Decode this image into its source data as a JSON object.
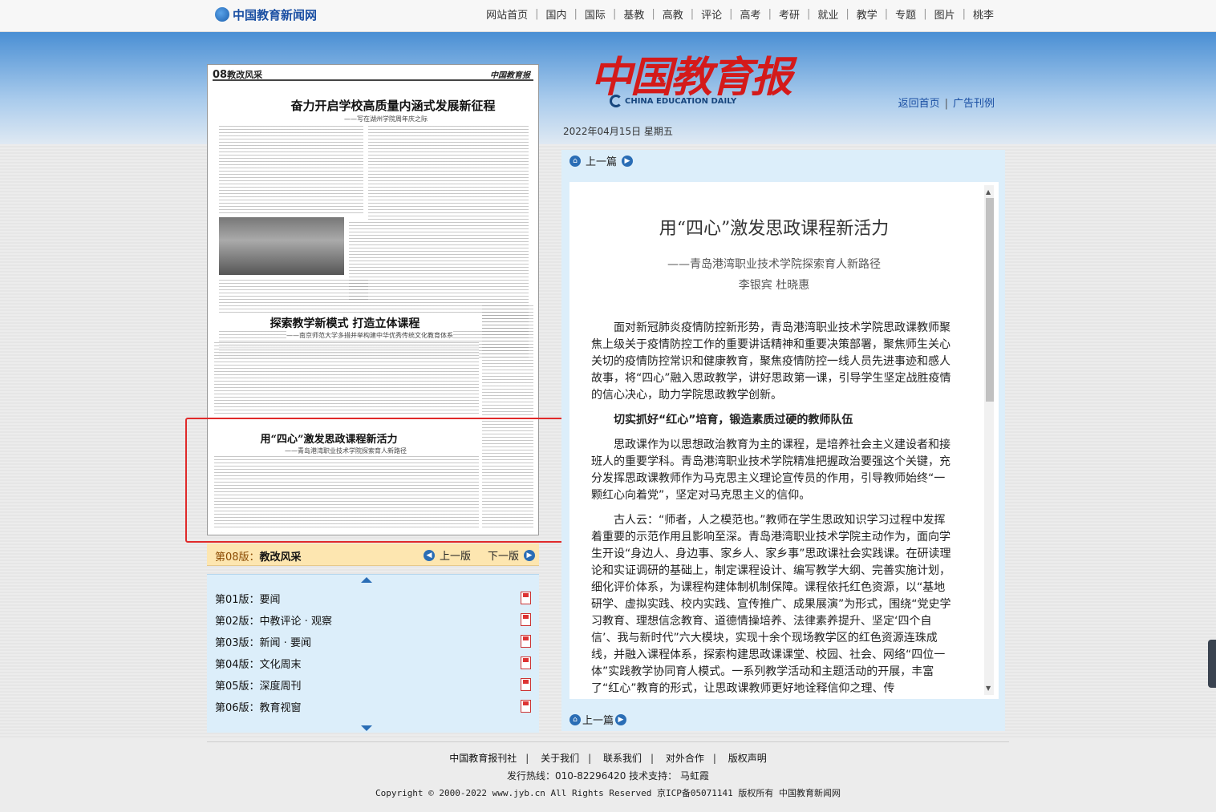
{
  "site": {
    "logo_text": "中国教育新闻网",
    "nav": [
      "网站首页",
      "国内",
      "国际",
      "基教",
      "高教",
      "评论",
      "高考",
      "考研",
      "就业",
      "教学",
      "专题",
      "图片",
      "桃李"
    ]
  },
  "masthead": {
    "paper_title": "中国教育报",
    "paper_en": "CHINA EDUCATION DAILY",
    "links": [
      "返回首页",
      "广告刊例"
    ],
    "date": "2022年04月15日 星期五"
  },
  "page_image": {
    "page_number": "08",
    "page_name": "教改风采",
    "paper_name_right": "中国教育报",
    "headline1": "奋力开启学校高质量内涵式发展新征程",
    "sub1": "——写在湖州学院周年庆之际",
    "headline2": "探索教学新模式 打造立体课程",
    "sub2": "——南京师范大学多措并举构建中华优秀传统文化教育体系",
    "headline3": "用“四心”激发思政课程新活力",
    "sub3": "——青岛港湾职业技术学院探索育人新路径"
  },
  "page_bar": {
    "current_prefix": "第08版：",
    "current_name": "教改风采",
    "prev": "上一版",
    "next": "下一版"
  },
  "page_list": [
    {
      "prefix": "第01版：",
      "name": "要闻"
    },
    {
      "prefix": "第02版：",
      "name": "中教评论 · 观察"
    },
    {
      "prefix": "第03版：",
      "name": "新闻 · 要闻"
    },
    {
      "prefix": "第04版：",
      "name": "文化周末"
    },
    {
      "prefix": "第05版：",
      "name": "深度周刊"
    },
    {
      "prefix": "第06版：",
      "name": "教育视窗"
    }
  ],
  "article": {
    "prev_top": "上一篇",
    "prev_bottom": "上一篇",
    "title": "用“四心”激发思政课程新活力",
    "subtitle": "——青岛港湾职业技术学院探索育人新路径",
    "authors": "李银宾  杜晓惠",
    "p1": "面对新冠肺炎疫情防控新形势，青岛港湾职业技术学院思政课教师聚焦上级关于疫情防控工作的重要讲话精神和重要决策部署，聚焦师生关心关切的疫情防控常识和健康教育，聚焦疫情防控一线人员先进事迹和感人故事，将“四心”融入思政教学，讲好思政第一课，引导学生坚定战胜疫情的信心决心，助力学院思政教学创新。",
    "h1": "切实抓好“红心”培育，锻造素质过硬的教师队伍",
    "p2": "思政课作为以思想政治教育为主的课程，是培养社会主义建设者和接班人的重要学科。青岛港湾职业技术学院精准把握政治要强这个关键，充分发挥思政课教师作为马克思主义理论宣传员的作用，引导教师始终“一颗红心向着党”，坚定对马克思主义的信仰。",
    "p3": "古人云：“师者，人之模范也。”教师在学生思政知识学习过程中发挥着重要的示范作用且影响至深。青岛港湾职业技术学院主动作为，面向学生开设“身边人、身边事、家乡人、家乡事”思政课社会实践课。在研读理论和实证调研的基础上，制定课程设计、编写教学大纲、完善实施计划，细化评价体系，为课程构建体制机制保障。课程依托红色资源，以“基地研学、虚拟实践、校内实践、宣传推广、成果展演”为形式，围绕“党史学习教育、理想信念教育、道德情操培养、法律素养提升、坚定‘四个自信’、我与新时代”六大模块，实现十余个现场教学区的红色资源连珠成线，并融入课程体系，探索构建思政课课堂、校园、社会、网络“四位一体”实践教学协同育人模式。一系列教学活动和主题活动的开展，丰富了“红心”教育的形式，让思政课教师更好地诠释信仰之理、传"
  },
  "footer": {
    "links": [
      "中国教育报刊社",
      "关于我们",
      "联系我们",
      "对外合作",
      "版权声明"
    ],
    "hotline": "发行热线：010-82296420 技术支持： 马虹霞",
    "copyright": "Copyright © 2000-2022 www.jyb.cn All Rights Reserved 京ICP备05071141 版权所有 中国教育新闻网"
  }
}
